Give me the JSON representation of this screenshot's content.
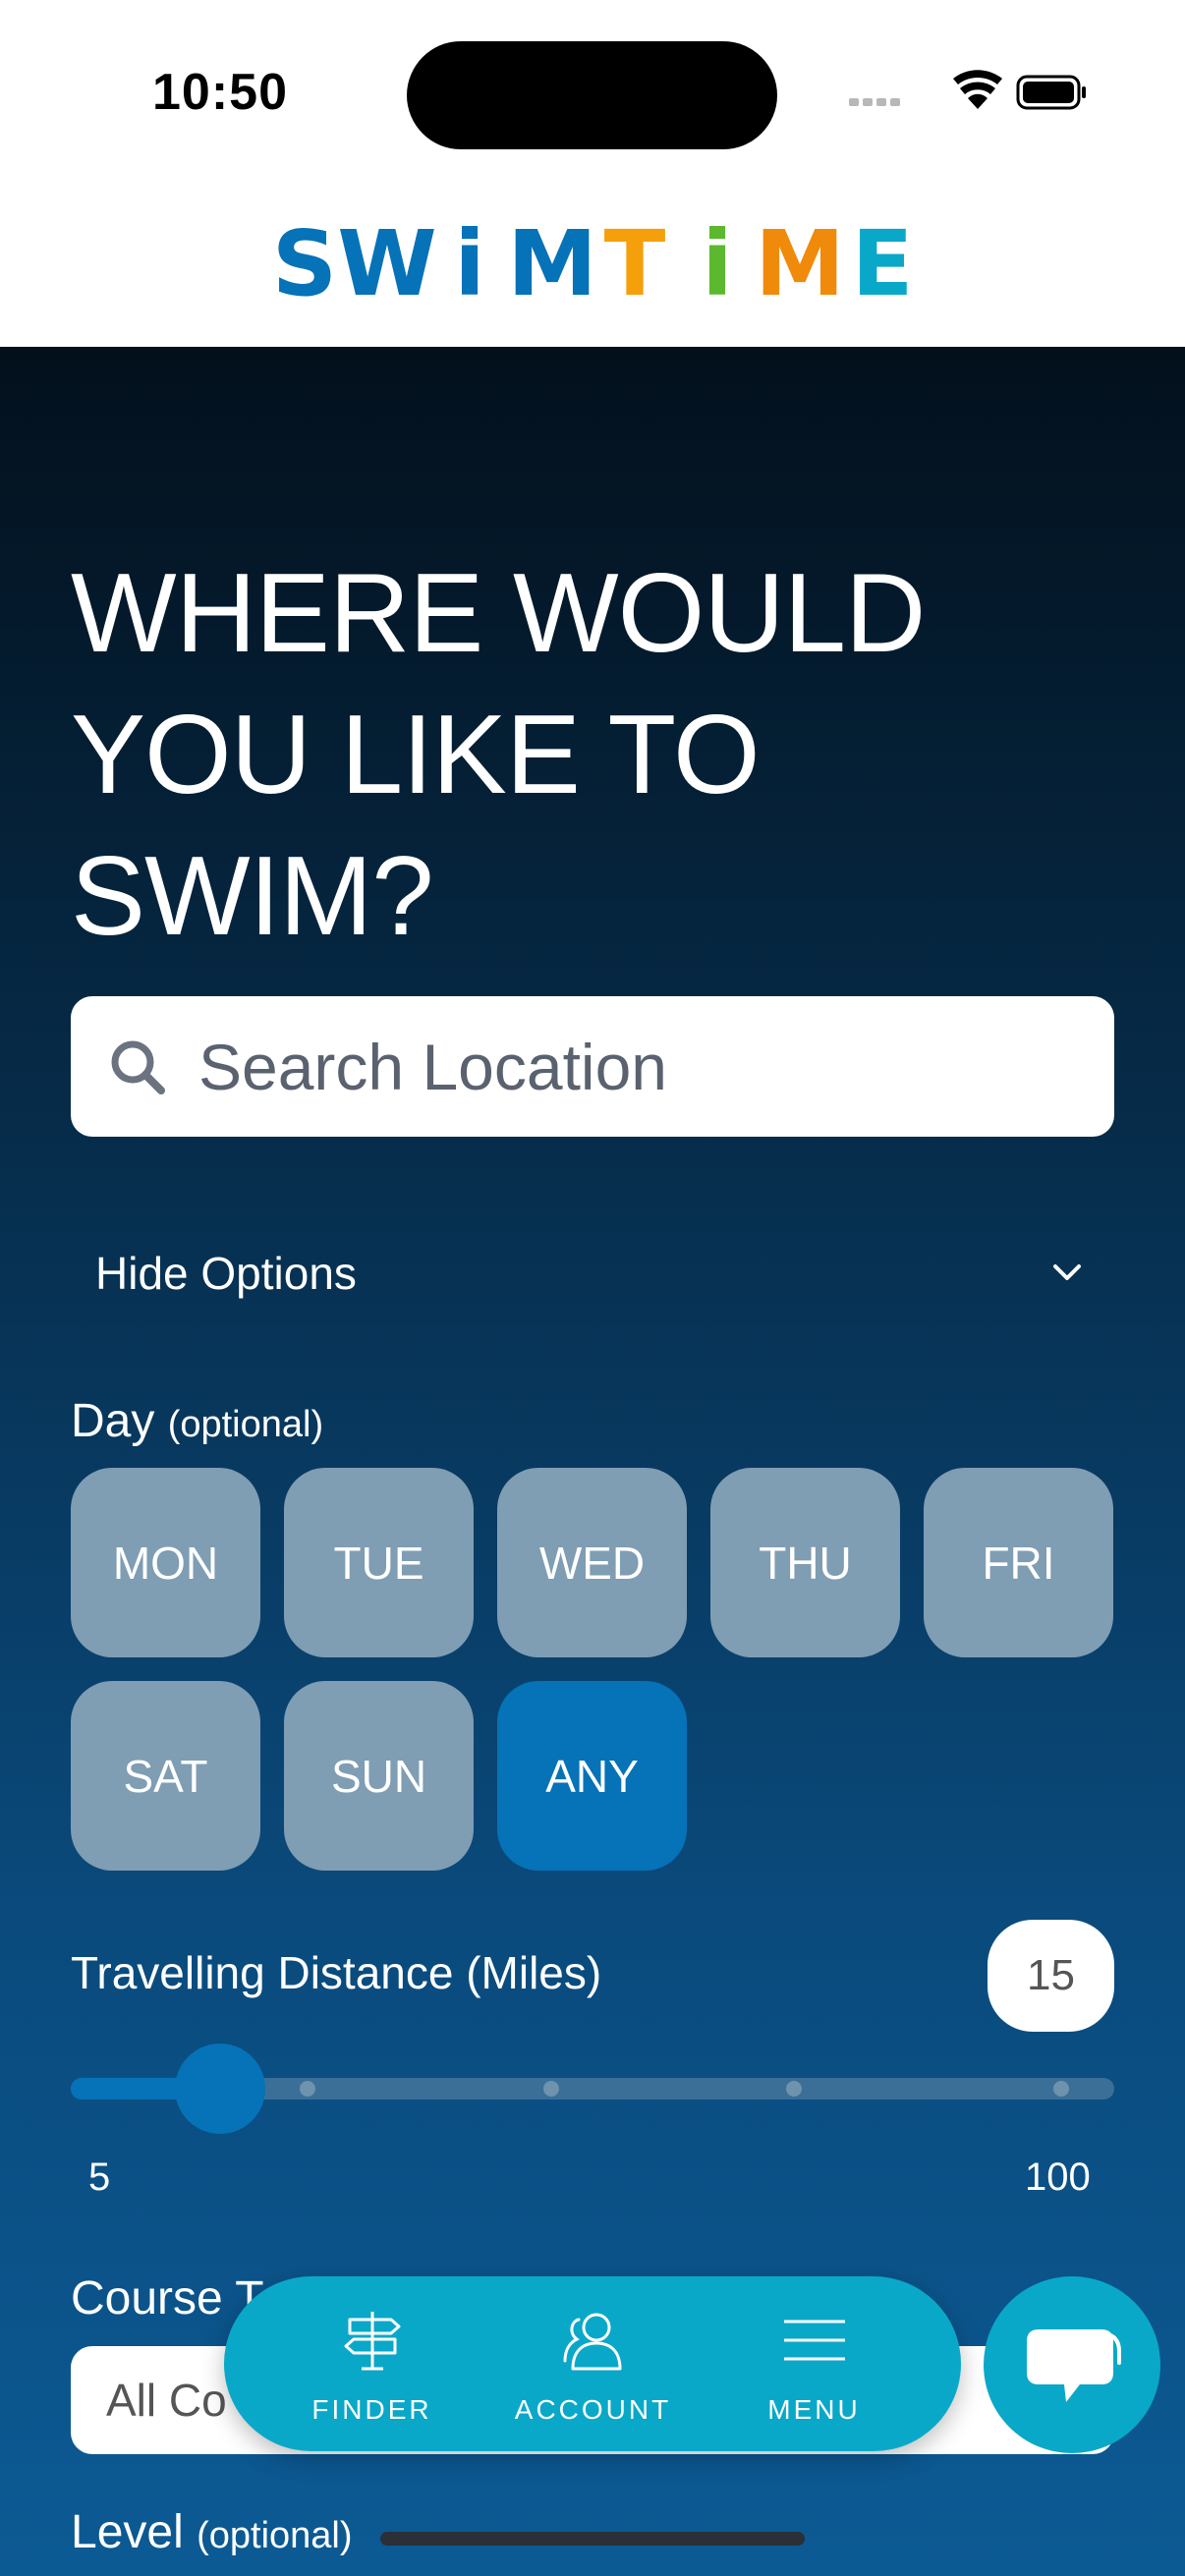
{
  "status_bar": {
    "time": "10:50"
  },
  "header": {
    "logo_letters": [
      "S",
      "W",
      "i",
      "M",
      "T",
      "i",
      "M",
      "E"
    ],
    "logo_colors": [
      "#0672b8",
      "#0672b8",
      "#0672b8",
      "#0672b8",
      "#f5a00a",
      "#5cb82e",
      "#f08a0a",
      "#0aa8c8"
    ]
  },
  "hero": {
    "title": "WHERE WOULD\nYOU LIKE TO\nSWIM?"
  },
  "search": {
    "placeholder": "Search Location"
  },
  "options": {
    "toggle_label": "Hide Options"
  },
  "day": {
    "label": "Day",
    "optional": "(optional)",
    "days": [
      "MON",
      "TUE",
      "WED",
      "THU",
      "FRI",
      "SAT",
      "SUN",
      "ANY"
    ],
    "selected": "ANY"
  },
  "distance": {
    "label": "Travelling Distance (Miles)",
    "value": "15",
    "min": "5",
    "max": "100",
    "fraction": 0.105
  },
  "course": {
    "label": "Course T",
    "selected": "All Co"
  },
  "level": {
    "label": "Level",
    "optional": "(optional)"
  },
  "nav": {
    "items": [
      {
        "label": "FINDER",
        "icon": "signpost-icon"
      },
      {
        "label": "ACCOUNT",
        "icon": "user-icon"
      },
      {
        "label": "MENU",
        "icon": "hamburger-icon"
      }
    ]
  },
  "colors": {
    "accent": "#0672b8",
    "day_inactive": "#7f9db3",
    "nav": "#0aa8c8"
  }
}
